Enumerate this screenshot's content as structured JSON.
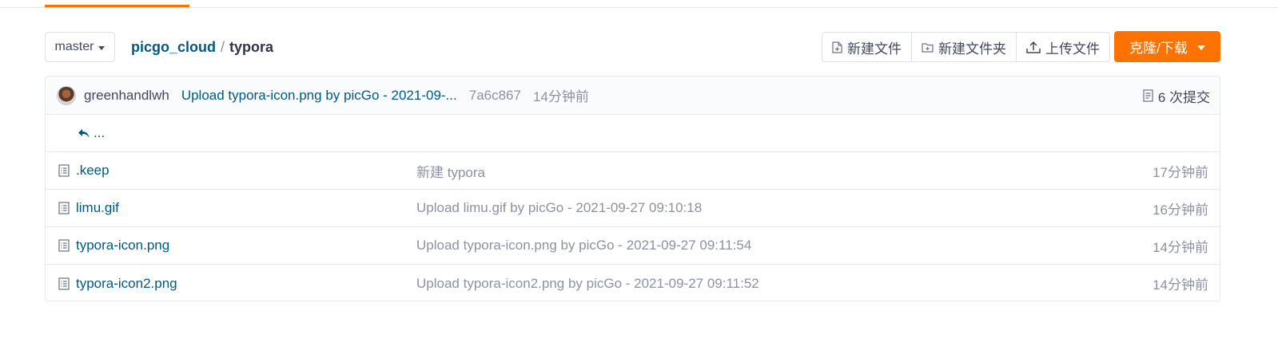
{
  "branch": {
    "label": "master"
  },
  "breadcrumb": {
    "repo": "picgo_cloud",
    "separator": "/",
    "current": "typora"
  },
  "actions": {
    "new_file": "新建文件",
    "new_folder": "新建文件夹",
    "upload_file": "上传文件",
    "clone_download": "克隆/下载"
  },
  "latest_commit": {
    "author": "greenhandlwh",
    "message": "Upload typora-icon.png by picGo - 2021-09-...",
    "sha": "7a6c867",
    "time": "14分钟前",
    "commit_count": "6 次提交"
  },
  "parent_dir": {
    "label": "..."
  },
  "files": [
    {
      "name": ".keep",
      "message": "新建 typora",
      "time": "17分钟前",
      "icon": "file-icon"
    },
    {
      "name": "limu.gif",
      "message": "Upload limu.gif by picGo - 2021-09-27 09:10:18",
      "time": "16分钟前",
      "icon": "file-icon"
    },
    {
      "name": "typora-icon.png",
      "message": "Upload typora-icon.png by picGo - 2021-09-27 09:11:54",
      "time": "14分钟前",
      "icon": "file-icon"
    },
    {
      "name": "typora-icon2.png",
      "message": "Upload typora-icon2.png by picGo - 2021-09-27 09:11:52",
      "time": "14分钟前",
      "icon": "file-icon"
    }
  ],
  "colors": {
    "accent": "#fe7300",
    "link": "#005980",
    "muted": "#8c92a4",
    "text": "#40485b",
    "border": "#e3e9ed"
  }
}
